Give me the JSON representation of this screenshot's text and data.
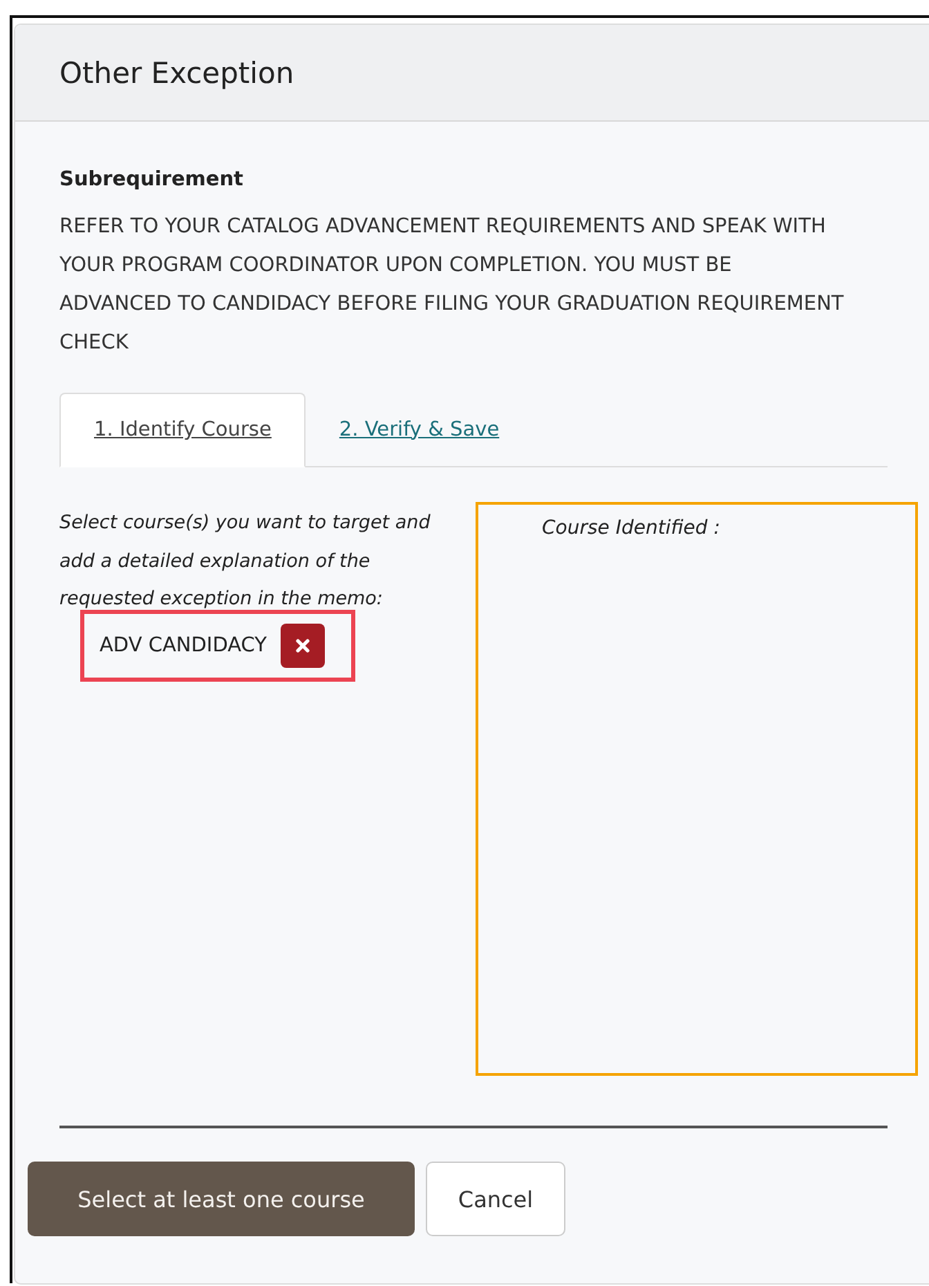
{
  "dialog": {
    "title": "Other Exception"
  },
  "subrequirement": {
    "heading": "Subrequirement",
    "text": "REFER TO YOUR CATALOG ADVANCEMENT REQUIREMENTS AND SPEAK WITH YOUR PROGRAM COORDINATOR UPON COMPLETION. YOU MUST BE ADVANCED TO CANDIDACY BEFORE FILING YOUR GRADUATION REQUIREMENT CHECK"
  },
  "tabs": [
    {
      "label": "1. Identify Course",
      "selected": true
    },
    {
      "label": "2. Verify & Save",
      "selected": false
    }
  ],
  "instructions": "Select course(s) you want to target and add a detailed explanation of the requested exception in the memo:",
  "courses": [
    {
      "label": "ADV CANDIDACY",
      "highlighted": true
    }
  ],
  "identified_panel": {
    "label": "Course Identified :"
  },
  "buttons": [
    {
      "label": "Select at least one course",
      "kind": "primary"
    },
    {
      "label": "Cancel",
      "kind": "secondary"
    }
  ]
}
